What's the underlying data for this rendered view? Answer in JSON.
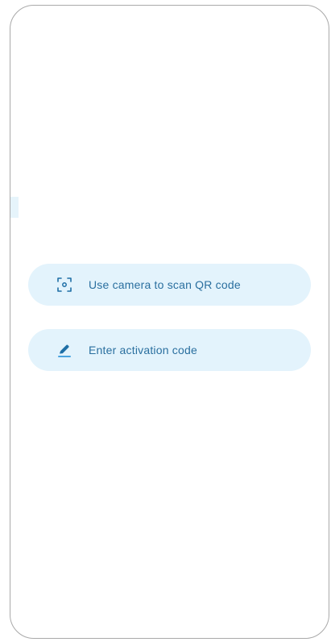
{
  "screen": {
    "actions": [
      {
        "label": "Use camera to scan QR code",
        "icon": "qr-scan-icon"
      },
      {
        "label": "Enter activation code",
        "icon": "pencil-icon"
      }
    ]
  },
  "colors": {
    "accent": "#1f6fa6",
    "button_background": "#e3f3fc",
    "frame_border": "#a9a9a9"
  }
}
